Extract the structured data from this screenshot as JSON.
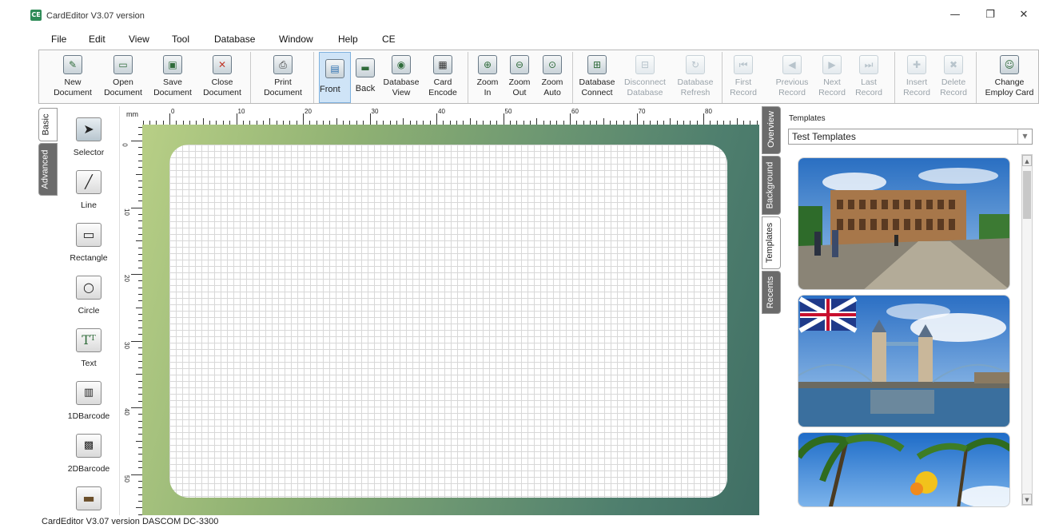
{
  "window": {
    "app_icon": "CE",
    "title": "CardEditor V3.07 version",
    "controls": [
      "—",
      "❐",
      "✕"
    ]
  },
  "menu": [
    "File",
    "Edit",
    "View",
    "Tool",
    "Database",
    "Window",
    "Help",
    "CE"
  ],
  "toolbar": {
    "new": [
      "New",
      "Document"
    ],
    "open": [
      "Open",
      "Document"
    ],
    "save": [
      "Save",
      "Document"
    ],
    "close": [
      "Close",
      "Document"
    ],
    "print": [
      "Print",
      "Document"
    ],
    "front": "Front",
    "back": "Back",
    "db_view": [
      "Database",
      "View"
    ],
    "card_encode": [
      "Card",
      "Encode"
    ],
    "zoom_in": [
      "Zoom",
      "In"
    ],
    "zoom_out": [
      "Zoom",
      "Out"
    ],
    "zoom_auto": [
      "Zoom",
      "Auto"
    ],
    "db_connect": [
      "Database",
      "Connect"
    ],
    "db_disconnect": [
      "Disconnect",
      "Database"
    ],
    "db_refresh": [
      "Database",
      "Refresh"
    ],
    "first": [
      "First",
      "Record"
    ],
    "previous": [
      "Previous",
      "Record"
    ],
    "next": [
      "Next",
      "Record"
    ],
    "last": [
      "Last",
      "Record"
    ],
    "insert": [
      "Insert",
      "Record"
    ],
    "delete": [
      "Delete",
      "Record"
    ],
    "change": [
      "Change",
      "Employ Card"
    ]
  },
  "left_tabs": {
    "basic": "Basic",
    "advanced": "Advanced"
  },
  "tools": {
    "selector": "Selector",
    "line": "Line",
    "rectangle": "Rectangle",
    "circle": "Circle",
    "text": "Text",
    "barcode1d": "1DBarcode",
    "barcode2d": "2DBarcode",
    "image": "Image"
  },
  "ruler": {
    "unit": "mm",
    "top_labels": [
      "0",
      "10",
      "20",
      "30",
      "40",
      "50",
      "60",
      "70",
      "80"
    ],
    "left_labels": [
      "0",
      "10",
      "20",
      "30",
      "40",
      "50"
    ]
  },
  "right_tabs": {
    "overview": "Overview",
    "background": "Background",
    "templates": "Templates",
    "recents": "Recents"
  },
  "templates": {
    "heading": "Templates",
    "selected": "Test Templates"
  },
  "status": "CardEditor V3.07 version DASCOM DC-3300",
  "colors": {
    "card_gradient_start": "#b8cf86",
    "card_gradient_end": "#3f6e64",
    "front_button_active": "#cfe4f7"
  }
}
